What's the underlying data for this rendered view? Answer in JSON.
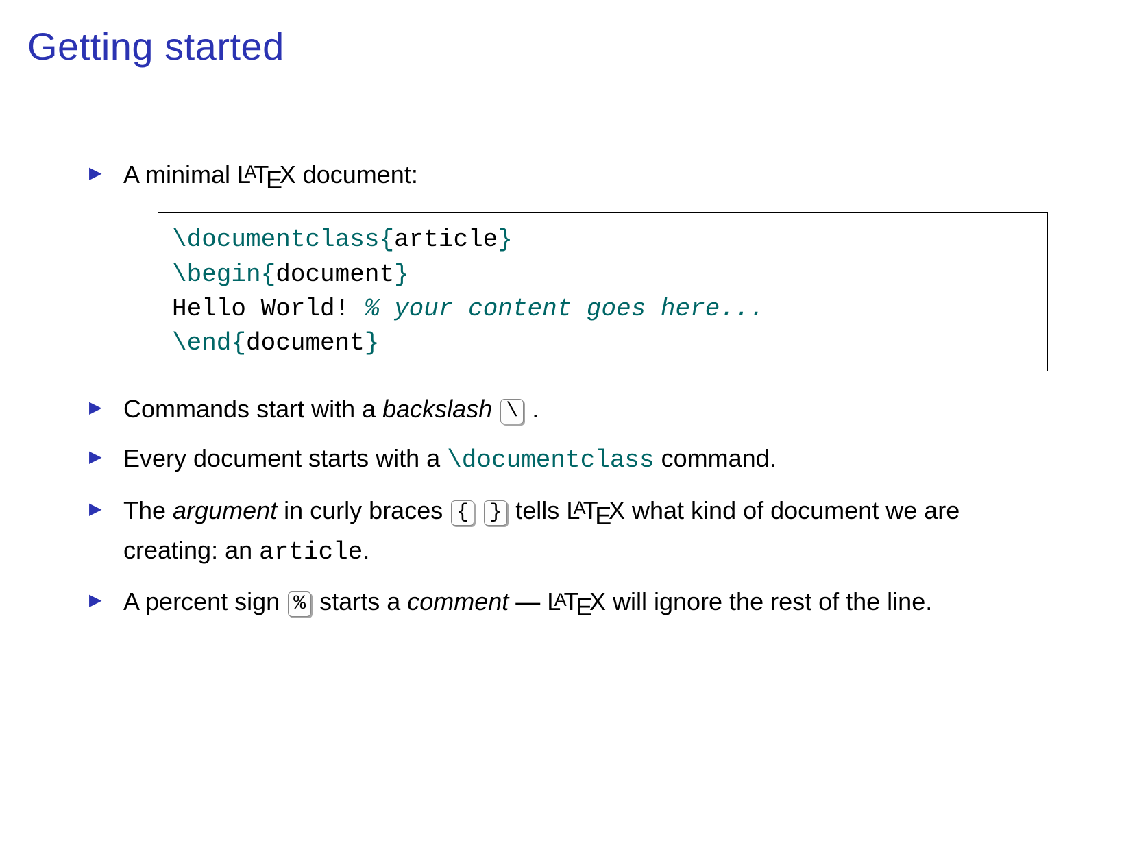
{
  "title": "Getting started",
  "bullets": {
    "b1_pre": "A minimal ",
    "b1_post": " document:",
    "b2_pre": "Commands start with a ",
    "b2_em": "backslash",
    "b2_key": "\\",
    "b2_post": " .",
    "b3_pre": "Every document starts with a ",
    "b3_cmd": "\\documentclass",
    "b3_post": " command.",
    "b4_pre": "The ",
    "b4_em": "argument",
    "b4_mid": " in curly braces ",
    "b4_key1": "{",
    "b4_key2": "}",
    "b4_mid2": "  tells ",
    "b4_mid3": " what kind of document we are creating: an ",
    "b4_tt": "article",
    "b4_post": ".",
    "b5_pre": "A percent sign ",
    "b5_key": "%",
    "b5_mid": "  starts a ",
    "b5_em": "comment",
    "b5_mid2": " — ",
    "b5_post": " will ignore the rest of the line."
  },
  "code": {
    "l1_cmd": "\\documentclass",
    "l1_arg": "article",
    "l2_cmd": "\\begin",
    "l2_arg": "document",
    "l3_txt": "Hello World! ",
    "l3_comment": "% your content goes here...",
    "l4_cmd": "\\end",
    "l4_arg": "document",
    "lbrace": "{",
    "rbrace": "}"
  }
}
